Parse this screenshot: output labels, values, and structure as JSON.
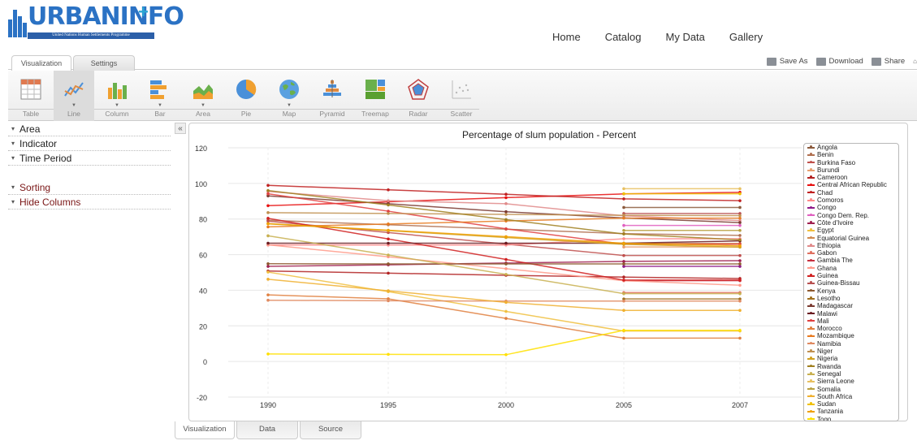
{
  "logo": {
    "text": "URBANINFO",
    "plus": "+",
    "subtitle": "United Nations Human Settlements Programme"
  },
  "nav": [
    "Home",
    "Catalog",
    "My Data",
    "Gallery"
  ],
  "top_tabs": [
    {
      "label": "Visualization",
      "active": true
    },
    {
      "label": "Settings",
      "active": false
    }
  ],
  "actions": {
    "save_as": "Save As",
    "download": "Download",
    "share": "Share"
  },
  "toolbar": [
    {
      "label": "Table",
      "icon": "table-icon",
      "caret": false
    },
    {
      "label": "Line",
      "icon": "line-chart-icon",
      "caret": true,
      "selected": true
    },
    {
      "label": "Column",
      "icon": "column-chart-icon",
      "caret": true
    },
    {
      "label": "Bar",
      "icon": "bar-chart-icon",
      "caret": true
    },
    {
      "label": "Area",
      "icon": "area-chart-icon",
      "caret": true
    },
    {
      "label": "Pie",
      "icon": "pie-chart-icon",
      "caret": false
    },
    {
      "label": "Map",
      "icon": "globe-icon",
      "caret": true
    },
    {
      "label": "Pyramid",
      "icon": "pyramid-chart-icon",
      "caret": false
    },
    {
      "label": "Treemap",
      "icon": "treemap-icon",
      "caret": false
    },
    {
      "label": "Radar",
      "icon": "radar-chart-icon",
      "caret": false
    },
    {
      "label": "Scatter",
      "icon": "scatter-chart-icon",
      "caret": false
    }
  ],
  "sidebar": {
    "collapse_symbol": "«",
    "items": [
      {
        "label": "Area",
        "red": false
      },
      {
        "label": "Indicator",
        "red": false
      },
      {
        "label": "Time Period",
        "red": false
      },
      {
        "label": "Sorting",
        "red": true
      },
      {
        "label": "Hide Columns",
        "red": true
      }
    ]
  },
  "bottom_tabs": [
    {
      "label": "Visualization",
      "active": true
    },
    {
      "label": "Data",
      "active": false
    },
    {
      "label": "Source",
      "active": false
    }
  ],
  "chart_data": {
    "type": "line",
    "title": "Percentage of slum population - Percent",
    "x": [
      "1990",
      "1995",
      "2000",
      "2005",
      "2007"
    ],
    "ylim": [
      -20,
      120
    ],
    "yticks": [
      -20,
      0,
      20,
      40,
      60,
      80,
      100,
      120
    ],
    "grid": true,
    "legend_position": "right",
    "series": [
      {
        "name": "Angola",
        "color": "#8b5a3c",
        "values": [
          null,
          null,
          null,
          86.5,
          86.5
        ]
      },
      {
        "name": "Benin",
        "color": "#b07050",
        "values": [
          79.3,
          76.8,
          74.3,
          71.8,
          70.8
        ]
      },
      {
        "name": "Burkina Faso",
        "color": "#c0504d",
        "values": [
          78.8,
          72.4,
          65.9,
          59.5,
          59.5
        ]
      },
      {
        "name": "Burundi",
        "color": "#e8a070",
        "values": [
          null,
          null,
          null,
          64.3,
          64.3
        ]
      },
      {
        "name": "Cameroon",
        "color": "#b22222",
        "values": [
          50.8,
          49.6,
          48.4,
          47.4,
          46.6
        ]
      },
      {
        "name": "Central African Republic",
        "color": "#e81010",
        "values": [
          87.5,
          89.7,
          92.0,
          94.1,
          95.0
        ]
      },
      {
        "name": "Chad",
        "color": "#c02020",
        "values": [
          98.9,
          96.4,
          93.9,
          91.3,
          90.3
        ]
      },
      {
        "name": "Comoros",
        "color": "#ff8a8a",
        "values": [
          65.4,
          65.4,
          65.4,
          68.9,
          68.9
        ]
      },
      {
        "name": "Congo",
        "color": "#8e1a8a",
        "values": [
          null,
          null,
          null,
          53.4,
          53.4
        ]
      },
      {
        "name": "Congo Dem. Rep.",
        "color": "#e060c0",
        "values": [
          null,
          null,
          null,
          76.4,
          76.4
        ]
      },
      {
        "name": "Côte d'Ivoire",
        "color": "#a02050",
        "values": [
          53.4,
          54.3,
          55.3,
          56.2,
          56.6
        ]
      },
      {
        "name": "Egypt",
        "color": "#f0c040",
        "values": [
          50.2,
          39.2,
          28.1,
          17.1,
          17.1
        ]
      },
      {
        "name": "Equatorial Guinea",
        "color": "#d08a50",
        "values": [
          null,
          null,
          null,
          66.3,
          66.3
        ]
      },
      {
        "name": "Ethiopia",
        "color": "#e08a8a",
        "values": [
          95.5,
          90.3,
          88.6,
          81.8,
          79.1
        ]
      },
      {
        "name": "Gabon",
        "color": "#e07060",
        "values": [
          null,
          null,
          null,
          38.7,
          38.7
        ]
      },
      {
        "name": "Gambia The",
        "color": "#c83040",
        "values": [
          null,
          null,
          null,
          45.4,
          45.4
        ]
      },
      {
        "name": "Ghana",
        "color": "#ff9a8a",
        "values": [
          65.5,
          58.8,
          52.1,
          45.4,
          42.8
        ]
      },
      {
        "name": "Guinea",
        "color": "#d02020",
        "values": [
          80.4,
          68.8,
          57.3,
          45.7,
          45.7
        ]
      },
      {
        "name": "Guinea-Bissau",
        "color": "#b85050",
        "values": [
          null,
          null,
          null,
          83.1,
          83.1
        ]
      },
      {
        "name": "Kenya",
        "color": "#8e5a30",
        "values": [
          54.9,
          54.8,
          54.8,
          54.8,
          54.8
        ]
      },
      {
        "name": "Lesotho",
        "color": "#a07020",
        "values": [
          null,
          null,
          null,
          35.1,
          35.1
        ]
      },
      {
        "name": "Madagascar",
        "color": "#7a3a30",
        "values": [
          93.0,
          88.6,
          84.1,
          80.6,
          78.0
        ]
      },
      {
        "name": "Malawi",
        "color": "#6a1a20",
        "values": [
          66.4,
          66.4,
          66.4,
          66.4,
          67.7
        ]
      },
      {
        "name": "Mali",
        "color": "#e04040",
        "values": [
          94.2,
          84.4,
          74.5,
          65.9,
          65.9
        ]
      },
      {
        "name": "Morocco",
        "color": "#e08040",
        "values": [
          37.4,
          35.2,
          24.2,
          13.1,
          13.1
        ]
      },
      {
        "name": "Mozambique",
        "color": "#e87a20",
        "values": [
          75.6,
          77.2,
          78.9,
          80.5,
          80.5
        ]
      },
      {
        "name": "Namibia",
        "color": "#e08a60",
        "values": [
          34.4,
          34.1,
          33.9,
          33.9,
          33.9
        ]
      },
      {
        "name": "Niger",
        "color": "#c09050",
        "values": [
          83.6,
          83.1,
          82.6,
          82.1,
          81.9
        ]
      },
      {
        "name": "Nigeria",
        "color": "#d0a020",
        "values": [
          77.3,
          73.5,
          69.6,
          65.8,
          64.2
        ]
      },
      {
        "name": "Rwanda",
        "color": "#a08020",
        "values": [
          96.0,
          87.9,
          79.7,
          71.6,
          68.3
        ]
      },
      {
        "name": "Senegal",
        "color": "#c8b050",
        "values": [
          70.6,
          59.8,
          48.9,
          38.1,
          38.1
        ]
      },
      {
        "name": "Sierra Leone",
        "color": "#e8c060",
        "values": [
          null,
          null,
          null,
          97.0,
          97.0
        ]
      },
      {
        "name": "Somalia",
        "color": "#b8a040",
        "values": [
          null,
          null,
          null,
          73.6,
          73.6
        ]
      },
      {
        "name": "South Africa",
        "color": "#f0b030",
        "values": [
          46.2,
          39.7,
          33.2,
          28.7,
          28.7
        ]
      },
      {
        "name": "Sudan",
        "color": "#f0c000",
        "values": [
          null,
          null,
          null,
          94.2,
          94.2
        ]
      },
      {
        "name": "Tanzania",
        "color": "#f0a000",
        "values": [
          77.4,
          73.7,
          70.1,
          66.4,
          65.0
        ]
      },
      {
        "name": "Togo",
        "color": "#ffe000",
        "values": [
          4.2,
          4.0,
          3.8,
          17.5,
          17.5
        ]
      }
    ]
  }
}
